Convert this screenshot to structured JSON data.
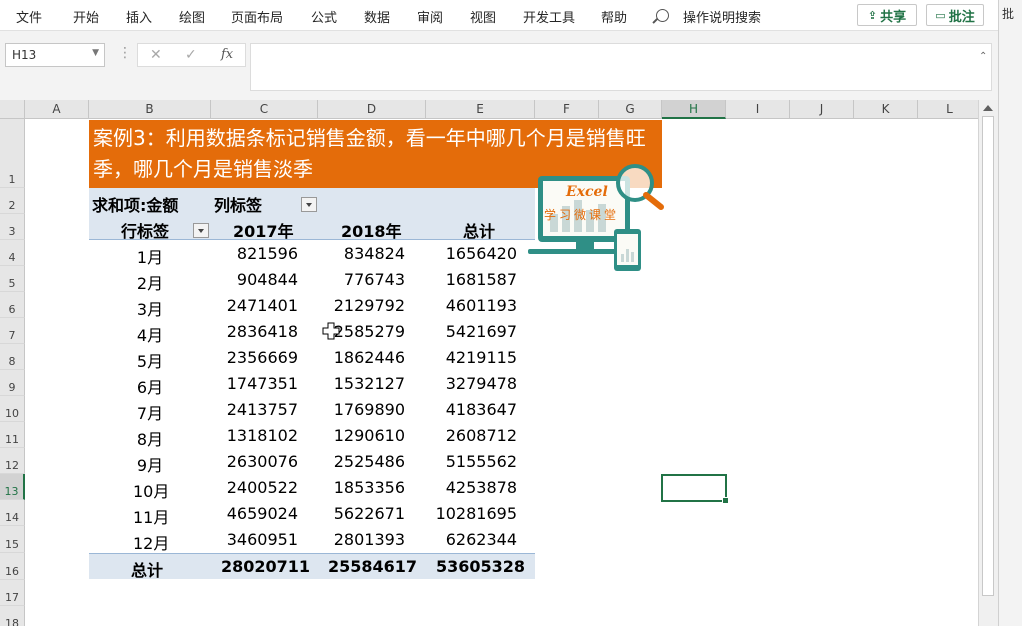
{
  "menu": {
    "items": [
      "文件",
      "开始",
      "插入",
      "绘图",
      "页面布局",
      "公式",
      "数据",
      "审阅",
      "视图",
      "开发工具",
      "帮助"
    ],
    "search_label": "操作说明搜索",
    "share_label": "共享",
    "comment_label": "批注",
    "edge_label": "批"
  },
  "formula_bar": {
    "name_box": "H13",
    "fx_label": "fx",
    "cancel_icon": "✕",
    "enter_icon": "✓"
  },
  "columns": [
    "A",
    "B",
    "C",
    "D",
    "E",
    "F",
    "G",
    "H",
    "I",
    "J",
    "K",
    "L"
  ],
  "selected_column": "H",
  "rows": [
    "1",
    "2",
    "3",
    "4",
    "5",
    "6",
    "7",
    "8",
    "9",
    "10",
    "11",
    "12",
    "13",
    "14",
    "15",
    "16",
    "17",
    "18"
  ],
  "selected_row": "13",
  "title": "案例3：利用数据条标记销售金额，看一年中哪几个月是销售旺季，哪几个月是销售淡季",
  "pivot": {
    "value_label": "求和项:金额",
    "col_label": "列标签",
    "row_label": "行标签",
    "headers": [
      "2017年",
      "2018年",
      "总计"
    ],
    "rows": [
      {
        "m": "1月",
        "a": "821596",
        "b": "834824",
        "t": "1656420"
      },
      {
        "m": "2月",
        "a": "904844",
        "b": "776743",
        "t": "1681587"
      },
      {
        "m": "3月",
        "a": "2471401",
        "b": "2129792",
        "t": "4601193"
      },
      {
        "m": "4月",
        "a": "2836418",
        "b": "2585279",
        "t": "5421697"
      },
      {
        "m": "5月",
        "a": "2356669",
        "b": "1862446",
        "t": "4219115"
      },
      {
        "m": "6月",
        "a": "1747351",
        "b": "1532127",
        "t": "3279478"
      },
      {
        "m": "7月",
        "a": "2413757",
        "b": "1769890",
        "t": "4183647"
      },
      {
        "m": "8月",
        "a": "1318102",
        "b": "1290610",
        "t": "2608712"
      },
      {
        "m": "9月",
        "a": "2630076",
        "b": "2525486",
        "t": "5155562"
      },
      {
        "m": "10月",
        "a": "2400522",
        "b": "1853356",
        "t": "4253878"
      },
      {
        "m": "11月",
        "a": "4659024",
        "b": "5622671",
        "t": "10281695"
      },
      {
        "m": "12月",
        "a": "3460951",
        "b": "2801393",
        "t": "6262344"
      }
    ],
    "total_label": "总计",
    "total_a": "28020711",
    "total_b": "25584617",
    "total_t": "53605328"
  },
  "logo": {
    "title": "Excel",
    "subtitle": "学习微课堂"
  },
  "colors": {
    "title_bg": "#e46c0a",
    "pivot_header_bg": "#dde6f0",
    "excel_green": "#217346"
  }
}
